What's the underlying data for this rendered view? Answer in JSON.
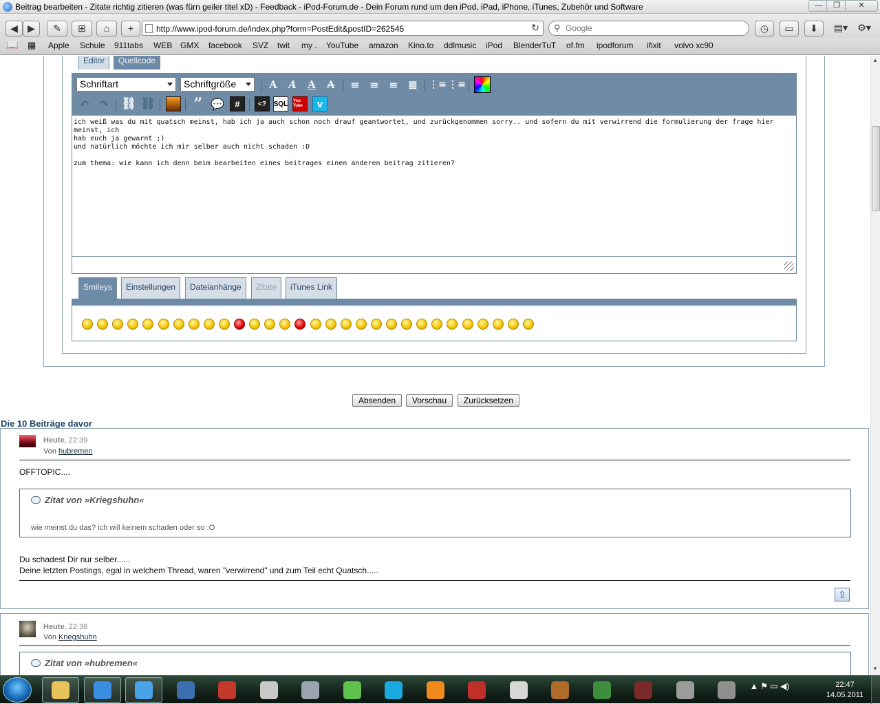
{
  "window": {
    "title": "Beitrag bearbeiten - Zitate richtig zitieren (was fürn geiler titel xD) - Feedback - iPod-Forum.de - Dein Forum rund um den iPod, iPad, iPhone, iTunes, Zubehör und Software",
    "minimize": "—",
    "maximize": "❐",
    "close": "✕"
  },
  "toolbar": {
    "back": "◀",
    "forward": "▶",
    "edit": "✎",
    "bookmark_add": "⊞",
    "home": "⌂",
    "new_tab": "+",
    "url": "http://www.ipod-forum.de/index.php?form=PostEdit&postID=262545",
    "reload": "↻",
    "search_placeholder": "Google",
    "history": "◷",
    "reader": "▭",
    "downloads": "⬇",
    "page_menu": "▤▾",
    "settings_menu": "⚙▾"
  },
  "bookmarks": [
    "Apple",
    "Schule",
    "911tabs",
    "WEB",
    "GMX",
    "facebook",
    "SVZ",
    "twit",
    "my .",
    "YouTube",
    "amazon",
    "Kino.to",
    "ddlmusic",
    "iPod",
    "BlenderTuT",
    "of.fm",
    "ipodforum",
    "ifixit",
    "volvo xc90"
  ],
  "editor": {
    "tabs": [
      {
        "label": "Editor",
        "active": false
      },
      {
        "label": "Quellcode",
        "active": true
      }
    ],
    "font_select": "Schriftart",
    "size_select": "Schriftgröße",
    "text": "ich weiß was du mit quatsch meinst, hab ich ja auch schon noch drauf geantwortet, und zurückgenommen sorry.. und sofern du mit verwirrend die formulierung der frage hier meinst, ich\nhab euch ja gewarnt ;)\nund natürlich möchte ich mir selber auch nicht schaden :D\n\nzum thema: wie kann ich denn beim bearbeiten eines beitrages einen anderen beitrag zitieren?",
    "quote_glyph": "”",
    "hash_glyph": "#",
    "code_glyph": "<?",
    "sql_label": "SQL",
    "youtube_label": "You Tube",
    "vimeo_label": "v"
  },
  "lower_tabs": [
    {
      "label": "Smileys",
      "state": "active"
    },
    {
      "label": "Einstellungen",
      "state": "inactive"
    },
    {
      "label": "Dateianhänge",
      "state": "inactive"
    },
    {
      "label": "Zitate",
      "state": "disabled"
    },
    {
      "label": "iTunes Link",
      "state": "inactive"
    }
  ],
  "smileys": [
    "smile",
    "sad",
    "wink",
    "tongue",
    "cool",
    "biggrin",
    "crying",
    "rolleyes",
    "huh",
    "confused",
    "mad",
    "angry",
    "blink",
    "question",
    "evil",
    "neutral",
    "thinking",
    "whistle",
    "thumbup",
    "grin",
    "thumbsup-cool",
    "laugh",
    "dead",
    "sleeping",
    "unsure",
    "pleased",
    "sly",
    "happy",
    "questionmark",
    "exclamation"
  ],
  "form_buttons": {
    "submit": "Absenden",
    "preview": "Vorschau",
    "reset": "Zurücksetzen"
  },
  "previous_posts": {
    "heading": "Die 10 Beiträge davor",
    "posts": [
      {
        "date": "Heute",
        "time": ", 22:39",
        "by": "Von",
        "author": "hubremen",
        "intro": "OFFTOPIC....",
        "quote_title": "Zitat von »Kriegshuhn«",
        "quote_text": "wie meinst du das? ich will keinem schaden oder so :O",
        "body_line1": "Du schadest Dir nur selber......",
        "body_line2": "Deine letzten Postings, egal in welchem Thread, waren \"verwirrend\" und zum Teil echt Quatsch....."
      },
      {
        "date": "Heute",
        "time": ", 22:36",
        "by": "Von",
        "author": "Kriegshuhn",
        "quote_title": "Zitat von »hubremen«"
      }
    ],
    "top_button": "⇧"
  },
  "taskbar": {
    "apps": [
      "explorer",
      "itunes",
      "safari",
      "thunderbird",
      "filezilla",
      "usb-drive",
      "photo-tool",
      "icq",
      "skype",
      "blender",
      "vlc-like",
      "assassins-creed",
      "age-of-empires",
      "call-of-duty",
      "battlefield",
      "counter-strike",
      "battlefield-2142"
    ],
    "tray_icons": "▲  ⚑  ▭  ◀)",
    "time": "22:47",
    "date": "14.05.2011"
  }
}
